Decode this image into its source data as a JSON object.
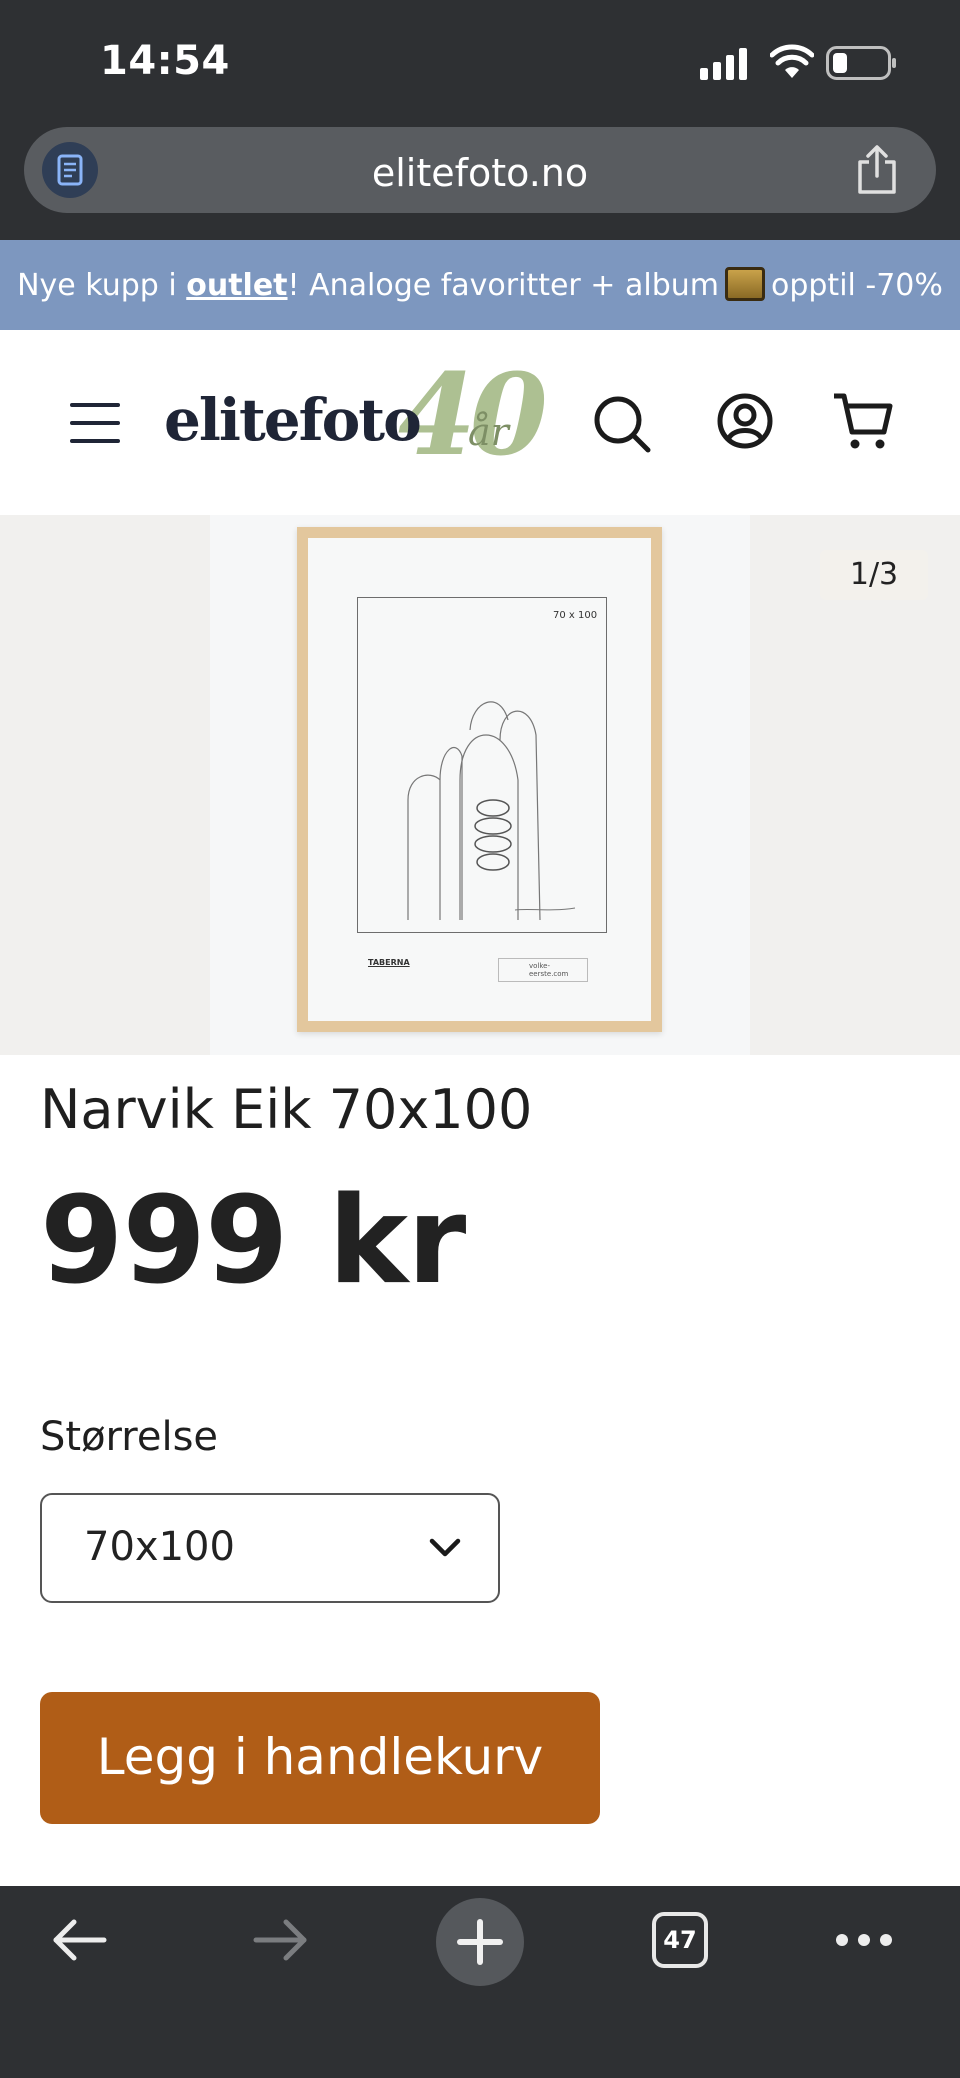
{
  "status_bar": {
    "time": "14:54"
  },
  "browser": {
    "url": "elitefoto.no",
    "tab_count": "47"
  },
  "promo": {
    "prefix": "Nye kupp i ",
    "link": "outlet",
    "suffix_1": "! Analoge favoritter + album",
    "suffix_2": "opptil -70%"
  },
  "header": {
    "logo_text": "elitefoto",
    "logo_anniversary": "40",
    "logo_anniversary_suffix": "år"
  },
  "gallery": {
    "pager": "1/3",
    "mat_label": "70 x 100",
    "brand_small": "TABERNA",
    "info_small": "volke-eerste.com"
  },
  "product": {
    "title": "Narvik Eik 70x100",
    "price": "999 kr",
    "size_label": "Størrelse",
    "size_selected": "70x100",
    "add_to_cart": "Legg i handlekurv"
  },
  "colors": {
    "chrome": "#2e3033",
    "promo_bg": "#7d97bf",
    "cta": "#b05d17",
    "logo_dark": "#1f2536",
    "logo_green": "#a9bd8d"
  },
  "icons": [
    "reader-icon",
    "share-icon",
    "menu-icon",
    "search-icon",
    "account-icon",
    "cart-icon",
    "chevron-down-icon",
    "back-icon",
    "forward-icon",
    "new-tab-icon",
    "tabs-icon",
    "more-icon"
  ]
}
